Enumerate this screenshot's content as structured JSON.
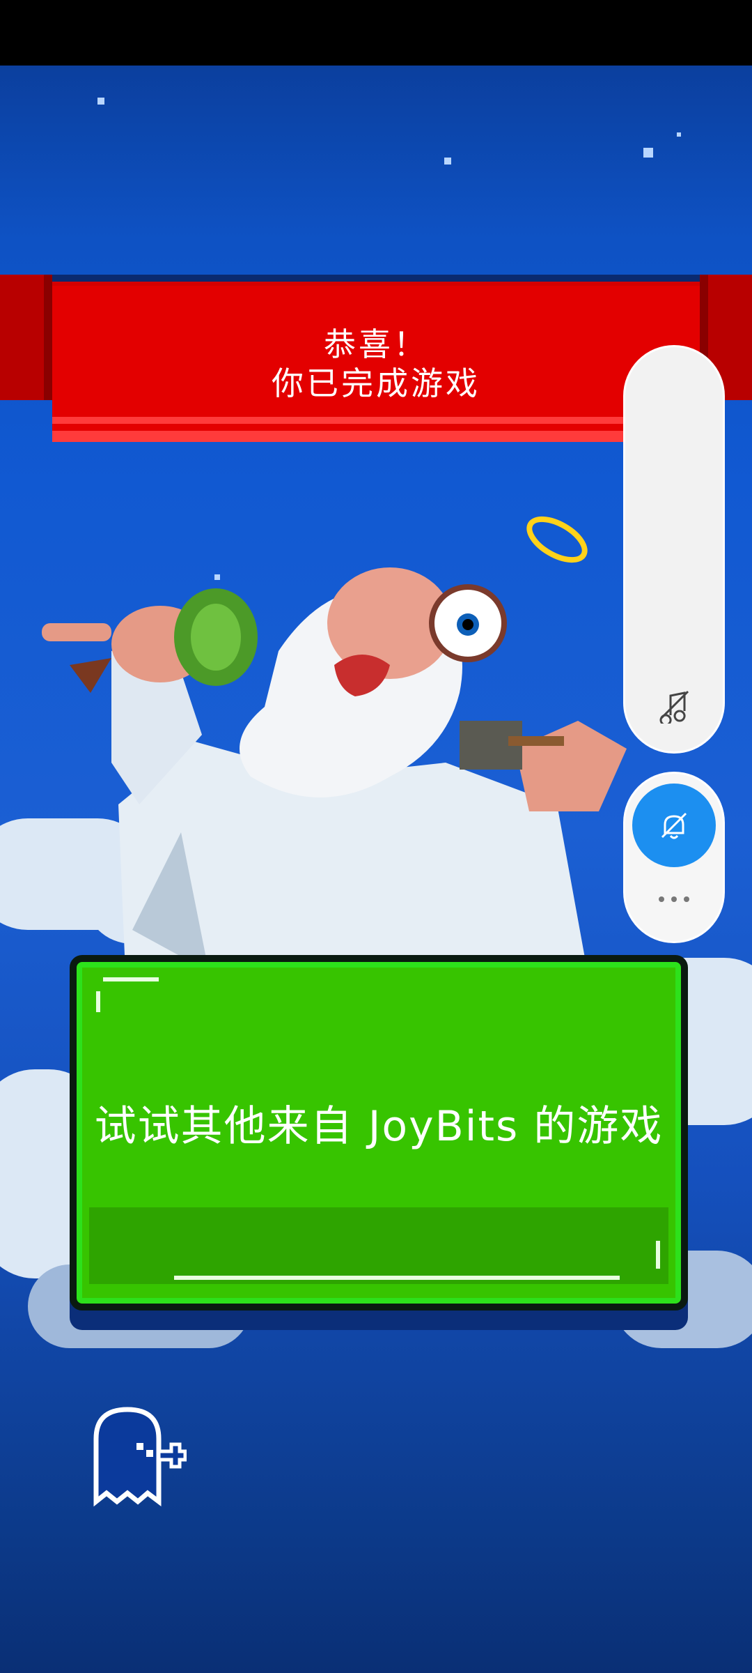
{
  "banner": {
    "line1": "恭喜！",
    "line2": "你已完成游戏"
  },
  "cta": {
    "label": "试试其他来自 JoyBits 的游戏"
  },
  "colors": {
    "sky": "#1159d2",
    "banner_red": "#e30000",
    "cta_green": "#37c400",
    "float_blue": "#1c8ff0"
  },
  "icons": {
    "side_panel": "music-off-icon",
    "float_button": "bell-off-icon",
    "more": "more-horizontal-icon",
    "ghost": "ghost-plus-icon"
  }
}
